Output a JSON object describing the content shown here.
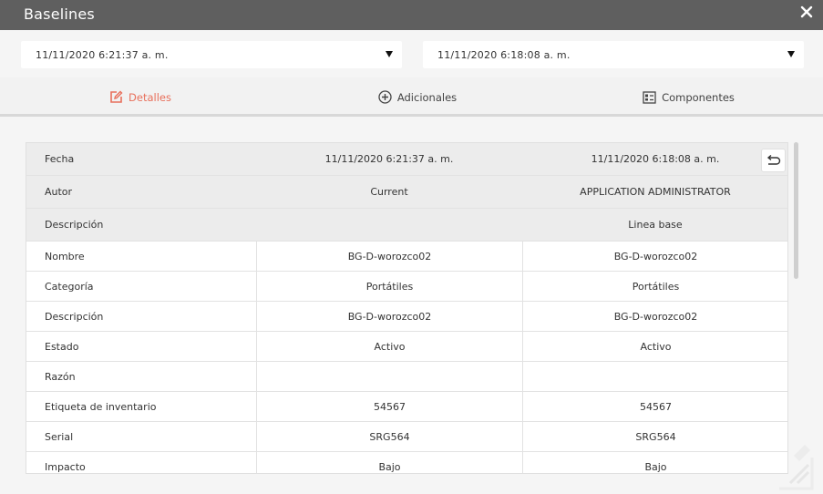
{
  "window": {
    "title": "Baselines",
    "close_icon": "close-icon"
  },
  "selectors": [
    {
      "value": "11/11/2020 6:21:37 a. m."
    },
    {
      "value": "11/11/2020 6:18:08 a. m."
    }
  ],
  "tabs": [
    {
      "label": "Detalles",
      "icon": "edit-icon",
      "active": true
    },
    {
      "label": "Adicionales",
      "icon": "plus-circle-icon",
      "active": false
    },
    {
      "label": "Componentes",
      "icon": "components-icon",
      "active": false
    }
  ],
  "header_rows": [
    {
      "label": "Fecha",
      "a": "11/11/2020 6:21:37 a. m.",
      "b": "11/11/2020 6:18:08 a. m."
    },
    {
      "label": "Autor",
      "a": "Current",
      "b": "APPLICATION ADMINISTRATOR"
    },
    {
      "label": "Descripción",
      "a": "",
      "b": "Linea base"
    }
  ],
  "rows": [
    {
      "label": "Nombre",
      "a": "BG-D-worozco02",
      "b": "BG-D-worozco02"
    },
    {
      "label": "Categoría",
      "a": "Portátiles",
      "b": "Portátiles"
    },
    {
      "label": "Descripción",
      "a": "BG-D-worozco02",
      "b": "BG-D-worozco02"
    },
    {
      "label": "Estado",
      "a": "Activo",
      "b": "Activo"
    },
    {
      "label": "Razón",
      "a": "",
      "b": ""
    },
    {
      "label": "Etiqueta de inventario",
      "a": "54567",
      "b": "54567"
    },
    {
      "label": "Serial",
      "a": "SRG564",
      "b": "SRG564"
    },
    {
      "label": "Impacto",
      "a": "Bajo",
      "b": "Bajo"
    }
  ],
  "colors": {
    "accent": "#e8705c",
    "titlebar": "#5f5f5f"
  }
}
